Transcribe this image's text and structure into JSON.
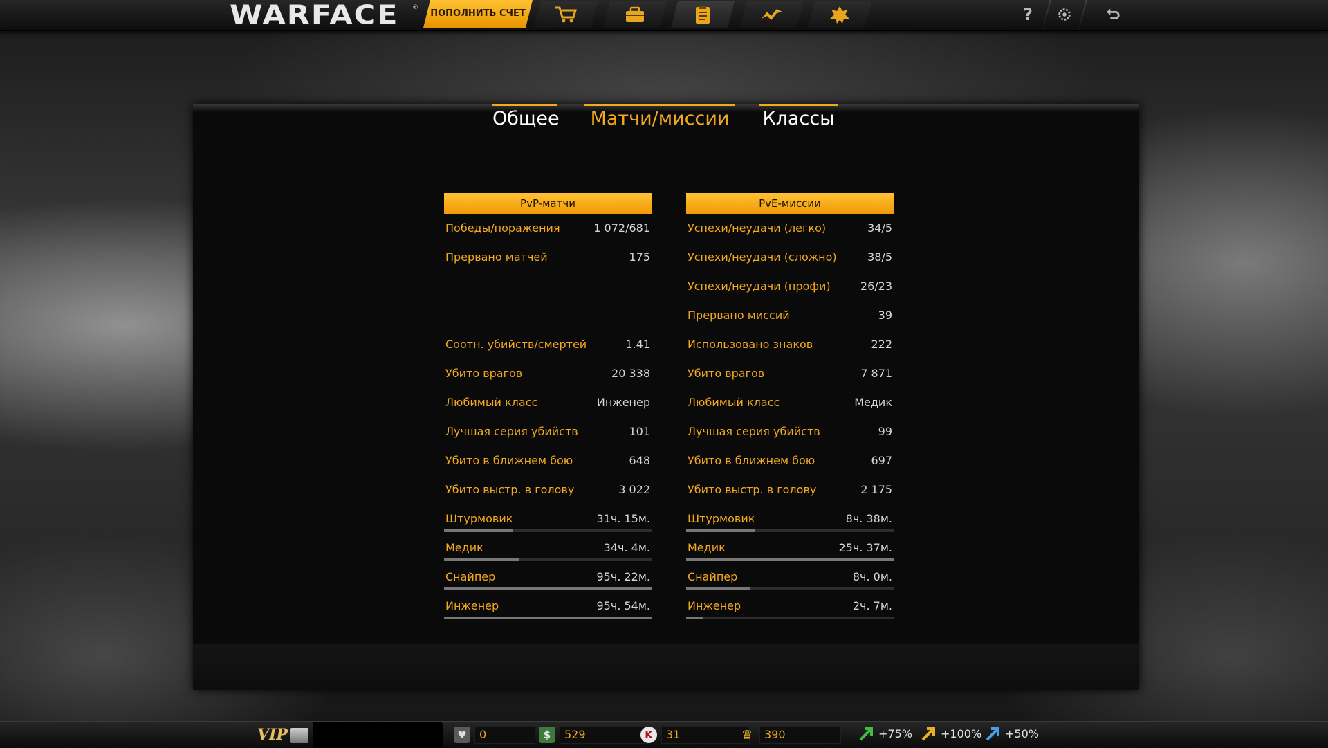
{
  "topbar": {
    "logo": "WARFACE",
    "logo_tm": "®",
    "topup_label": "ПОПОЛНИТЬ СЧЕТ",
    "nav_icons": [
      "shop-cart-icon",
      "inventory-box-icon",
      "stats-clipboard-icon",
      "achievements-icon",
      "clan-emblem-icon"
    ],
    "active_nav": "stats-clipboard-icon",
    "help_label": "?",
    "settings_icon": "gear-icon",
    "exit_icon": "exit-icon"
  },
  "tabs": [
    {
      "label": "Общее",
      "state": "inactive"
    },
    {
      "label": "Матчи/миссии",
      "state": "active"
    },
    {
      "label": "Классы",
      "state": "inactive"
    }
  ],
  "pvp": {
    "header": "PvP-матчи",
    "rows": [
      {
        "label": "Победы/поражения",
        "value": "1 072/681"
      },
      {
        "label": "Прервано матчей",
        "value": "175"
      },
      {
        "label": "Соотн. убийств/смертей",
        "value": "1.41"
      },
      {
        "label": "Убито врагов",
        "value": "20 338"
      },
      {
        "label": "Любимый класс",
        "value": "Инженер"
      },
      {
        "label": "Лучшая серия убийств",
        "value": "101"
      },
      {
        "label": "Убито в ближнем бою",
        "value": "648"
      },
      {
        "label": "Убито выстр. в голову",
        "value": "3 022"
      }
    ],
    "class_rows": [
      {
        "label": "Штурмовик",
        "value": "31ч. 15м.",
        "fill": 0.33
      },
      {
        "label": "Медик",
        "value": "34ч. 4м.",
        "fill": 0.36
      },
      {
        "label": "Снайпер",
        "value": "95ч. 22м.",
        "fill": 1.0
      },
      {
        "label": "Инженер",
        "value": "95ч. 54м.",
        "fill": 1.0
      }
    ]
  },
  "pve": {
    "header": "PvE-миссии",
    "rows": [
      {
        "label": "Успехи/неудачи (легко)",
        "value": "34/5"
      },
      {
        "label": "Успехи/неудачи (сложно)",
        "value": "38/5"
      },
      {
        "label": "Успехи/неудачи (профи)",
        "value": "26/23"
      },
      {
        "label": "Прервано миссий",
        "value": "39"
      },
      {
        "label": "Использовано знаков",
        "value": "222"
      },
      {
        "label": "Убито врагов",
        "value": "7 871"
      },
      {
        "label": "Любимый класс",
        "value": "Медик"
      },
      {
        "label": "Лучшая серия убийств",
        "value": "99"
      },
      {
        "label": "Убито в ближнем бою",
        "value": "697"
      },
      {
        "label": "Убито выстр. в голову",
        "value": "2 175"
      }
    ],
    "class_rows": [
      {
        "label": "Штурмовик",
        "value": "8ч. 38м.",
        "fill": 0.33
      },
      {
        "label": "Медик",
        "value": "25ч. 37м.",
        "fill": 1.0
      },
      {
        "label": "Снайпер",
        "value": "8ч. 0м.",
        "fill": 0.31
      },
      {
        "label": "Инженер",
        "value": "2ч. 7м.",
        "fill": 0.08
      }
    ]
  },
  "bottombar": {
    "vip_label": "VIP",
    "currencies": [
      {
        "icon": "heart-shield-icon",
        "value": "0"
      },
      {
        "icon": "dollar-icon",
        "value": "529"
      },
      {
        "icon": "kredits-k-icon",
        "value": "31"
      },
      {
        "icon": "crown-icon",
        "value": "390"
      }
    ],
    "boosts": [
      {
        "icon": "xp-boost-arrow-icon",
        "value": "+75%",
        "color": "#3fbf3f"
      },
      {
        "icon": "money-boost-arrow-icon",
        "value": "+100%",
        "color": "#e8b020"
      },
      {
        "icon": "sp-boost-arrow-icon",
        "value": "+50%",
        "color": "#4aa0e8"
      }
    ]
  },
  "colors": {
    "accent": "#f2a81f",
    "value_text": "#d6d6d6",
    "panel_bg": "#0a0a0a"
  }
}
